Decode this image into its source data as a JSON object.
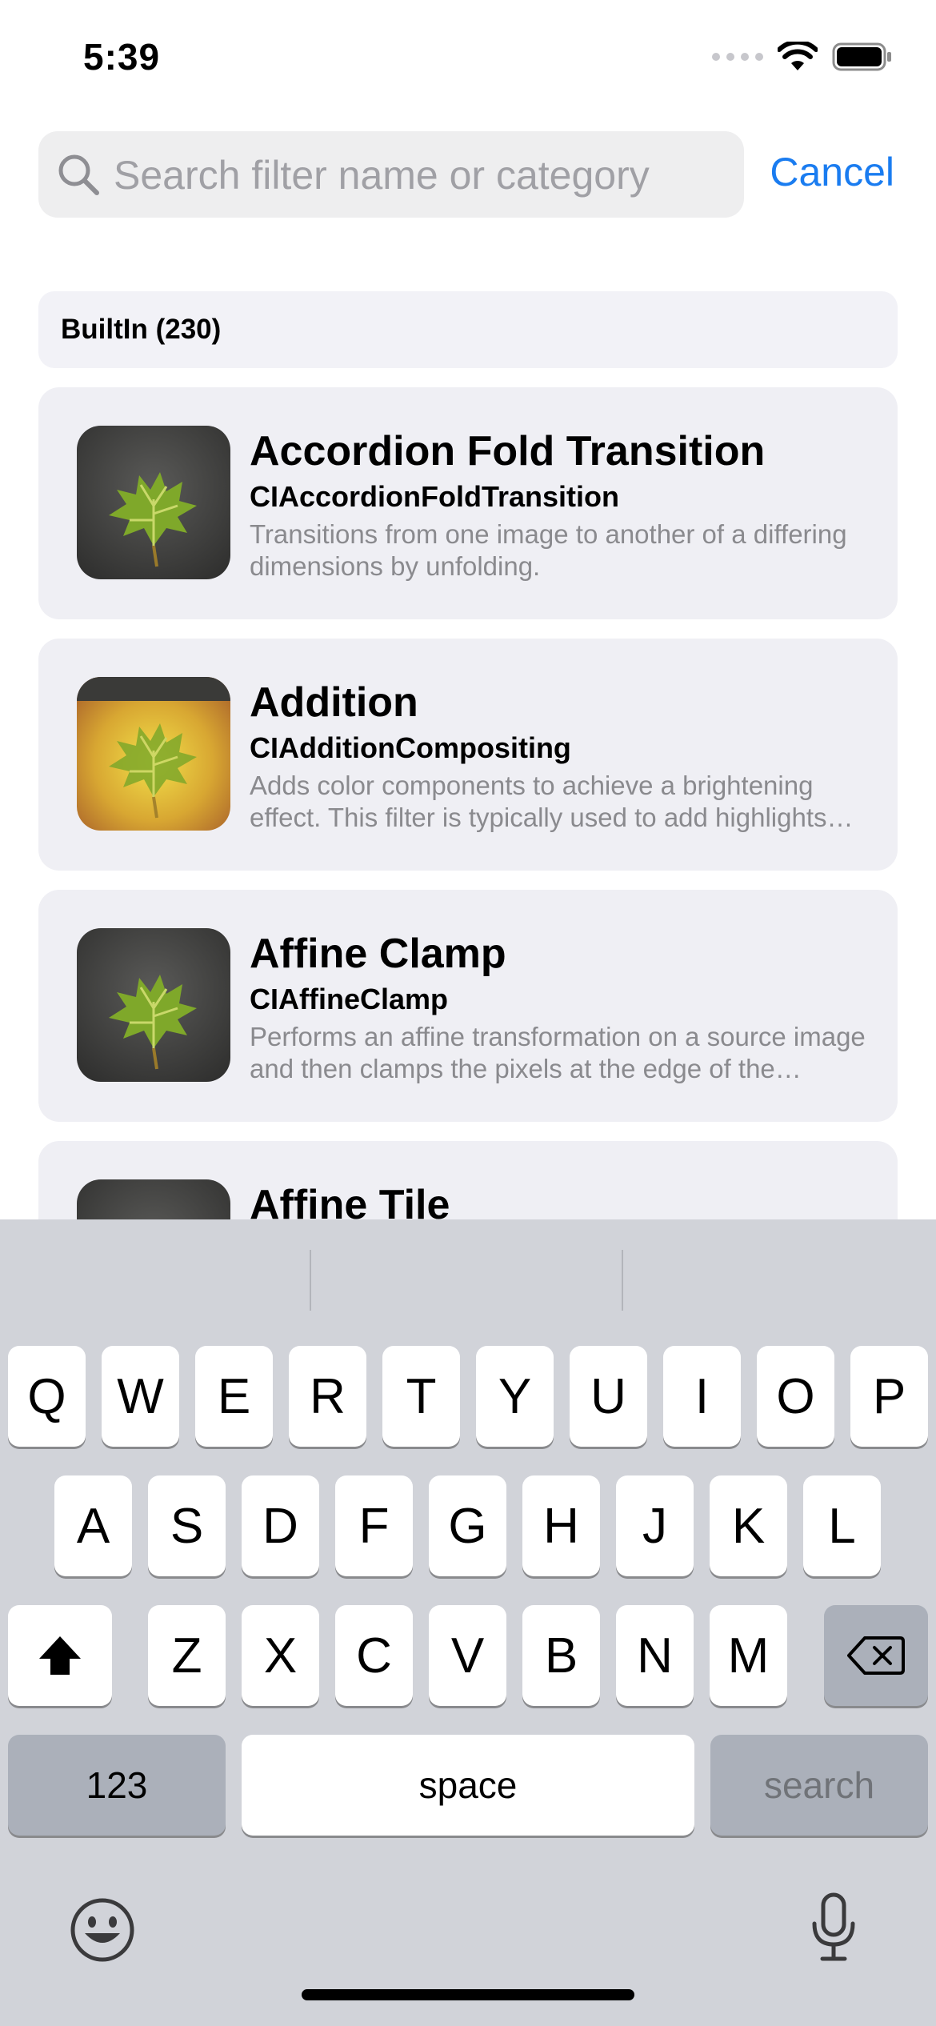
{
  "status_bar": {
    "time": "5:39"
  },
  "search": {
    "placeholder": "Search filter name or category",
    "value": "",
    "cancel_label": "Cancel"
  },
  "section": {
    "title": "BuiltIn (230)"
  },
  "filters": [
    {
      "name": "Accordion Fold Transition",
      "class_name": "CIAccordionFoldTransition",
      "description": "Transitions from one image to another of a differing dimensions by unfolding."
    },
    {
      "name": "Addition",
      "class_name": "CIAdditionCompositing",
      "description": "Adds color components to achieve a brightening effect. This filter is typically used to add highlights and lens flare effects."
    },
    {
      "name": "Affine Clamp",
      "class_name": "CIAffineClamp",
      "description": "Performs an affine transformation on a source image and then clamps the pixels at the edge of the transformed image."
    },
    {
      "name": "Affine Tile",
      "class_name": "",
      "description": ""
    }
  ],
  "keyboard": {
    "row1": [
      "Q",
      "W",
      "E",
      "R",
      "T",
      "Y",
      "U",
      "I",
      "O",
      "P"
    ],
    "row2": [
      "A",
      "S",
      "D",
      "F",
      "G",
      "H",
      "J",
      "K",
      "L"
    ],
    "row3": [
      "Z",
      "X",
      "C",
      "V",
      "B",
      "N",
      "M"
    ],
    "numbers_label": "123",
    "space_label": "space",
    "search_label": "search"
  },
  "colors": {
    "accent": "#1a7cf0",
    "card_background": "#efeff4",
    "keyboard_background": "#d1d3d9"
  },
  "icons": [
    "search-icon",
    "wifi-icon",
    "battery-icon",
    "shift-icon",
    "delete-icon",
    "emoji-icon",
    "microphone-icon"
  ]
}
